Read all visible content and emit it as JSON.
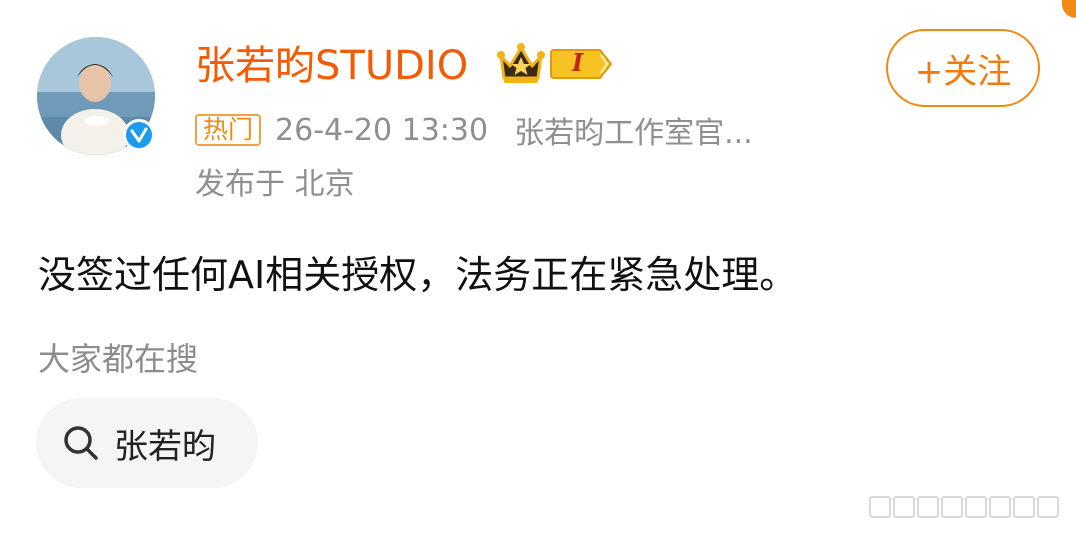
{
  "header": {
    "username": "张若昀STUDIO",
    "level_badge": "I",
    "follow_label": "+关注"
  },
  "meta": {
    "tag": "热门",
    "timestamp": "26-4-20 13:30",
    "source": "张若昀工作室官...",
    "location": "发布于 北京"
  },
  "post": {
    "text": "没签过任何AI相关授权，法务正在紧急处理。"
  },
  "search": {
    "heading": "大家都在搜",
    "chip_label": "张若昀"
  },
  "icons": {
    "avatar": "avatar-photo",
    "verified": "verified-check-icon",
    "crown": "crown-icon",
    "search": "search-icon"
  },
  "colors": {
    "accent": "#f25c05",
    "follow_border": "#f08a12",
    "verified": "#1d9bf0",
    "muted_text": "#8f8f8f"
  }
}
